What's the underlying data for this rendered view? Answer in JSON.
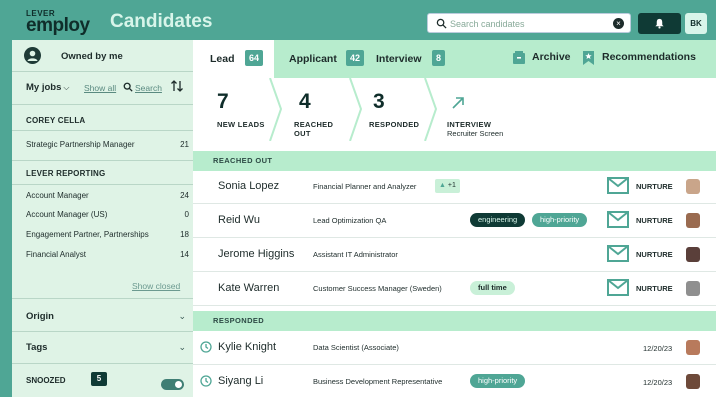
{
  "header": {
    "logo_small": "LEVER",
    "logo_big": "employ",
    "title": "Candidates",
    "search_placeholder": "Search candidates",
    "user_initials": "BK"
  },
  "sidebar": {
    "owned_label": "Owned by me",
    "my_jobs_label": "My jobs",
    "show_all": "Show all",
    "search": "Search",
    "groups": [
      {
        "title": "COREY CELLA",
        "jobs": [
          {
            "name": "Strategic Partnership Manager",
            "count": "21"
          }
        ]
      },
      {
        "title": "LEVER REPORTING",
        "jobs": [
          {
            "name": "Account Manager",
            "count": "24"
          },
          {
            "name": "Account Manager (US)",
            "count": "0"
          },
          {
            "name": "Engagement Partner, Partnerships",
            "count": "18"
          },
          {
            "name": "Financial Analyst",
            "count": "14"
          }
        ]
      }
    ],
    "show_closed": "Show closed",
    "filters": [
      "Origin",
      "Tags"
    ],
    "snoozed_label": "SNOOZED",
    "snoozed_count": "5"
  },
  "tabs": [
    {
      "label": "Lead",
      "count": "64"
    },
    {
      "label": "Applicant",
      "count": "42"
    },
    {
      "label": "Interview",
      "count": "8"
    }
  ],
  "actions": {
    "archive": "Archive",
    "recommendations": "Recommendations"
  },
  "stages": [
    {
      "num": "7",
      "label": "NEW LEADS"
    },
    {
      "num": "4",
      "label": "REACHED",
      "label2": "OUT"
    },
    {
      "num": "3",
      "label": "RESPONDED"
    },
    {
      "label": "INTERVIEW",
      "sub": "Recruiter Screen"
    }
  ],
  "sections": {
    "reached_out": "REACHED OUT",
    "responded": "RESPONDED"
  },
  "reached_out": [
    {
      "name": "Sonia Lopez",
      "role": "Financial Planner and Analyzer",
      "likes": "+1",
      "status": "NURTURE"
    },
    {
      "name": "Reid Wu",
      "role": "Lead Optimization QA",
      "tags": [
        "engineering",
        "high-priority"
      ],
      "status": "NURTURE"
    },
    {
      "name": "Jerome Higgins",
      "role": "Assistant IT Administrator",
      "status": "NURTURE"
    },
    {
      "name": "Kate Warren",
      "role": "Customer Success Manager (Sweden)",
      "tags": [
        "full time"
      ],
      "status": "NURTURE"
    }
  ],
  "responded": [
    {
      "name": "Kylie Knight",
      "role": "Data Scientist (Associate)",
      "date": "12/20/23"
    },
    {
      "name": "Siyang Li",
      "role": "Business Development Representative",
      "tags": [
        "high-priority"
      ],
      "date": "12/20/23"
    }
  ],
  "colors": {
    "brand": "#4fa695",
    "dark": "#0f3a35",
    "mint": "#b7eccd",
    "sidebar": "#dff3e6"
  }
}
